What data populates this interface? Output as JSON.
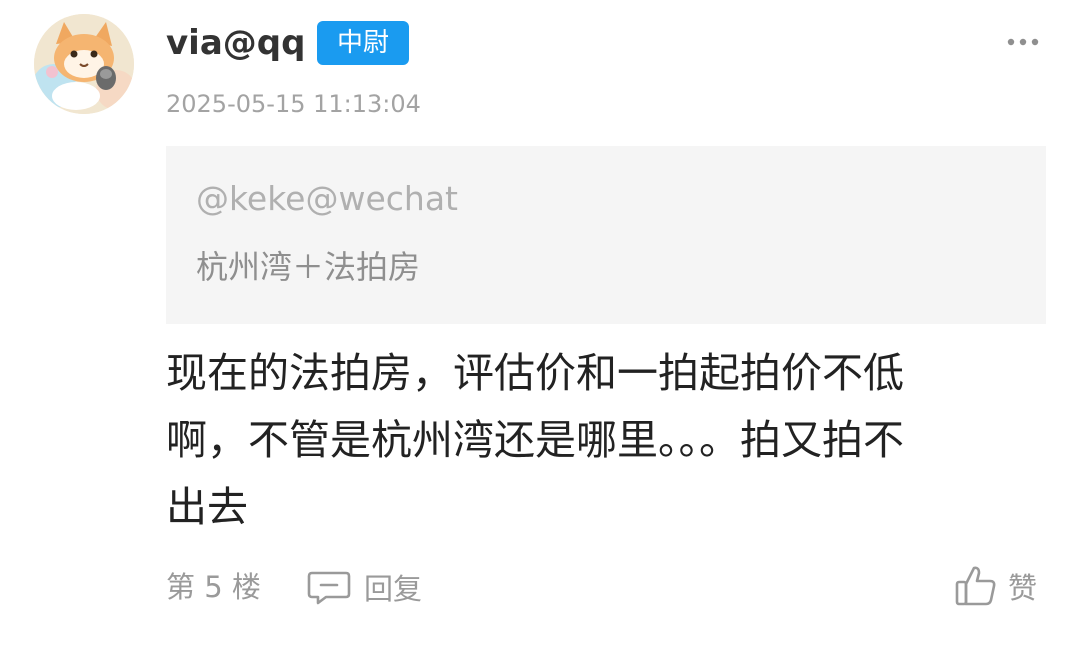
{
  "post": {
    "username": "via@qq",
    "rank_badge": "中尉",
    "timestamp": "2025-05-15 11:13:04",
    "avatar_icon": "cat-avatar",
    "more_icon": "more-dots-icon"
  },
  "quote": {
    "author": "@keke@wechat",
    "text": "杭州湾＋法拍房"
  },
  "comment": {
    "text": "现在的法拍房，评估价和一拍起拍价不低\n啊，不管是杭州湾还是哪里。。。拍又拍不\n出去"
  },
  "footer": {
    "floor": "第 5 楼",
    "reply_label": "回复",
    "like_label": "赞",
    "reply_icon": "comment-bubble-icon",
    "like_icon": "thumbs-up-icon"
  },
  "colors": {
    "badge_bg": "#1a9bf0",
    "quote_bg": "#f5f5f5",
    "muted_text": "#9a9a9a"
  }
}
